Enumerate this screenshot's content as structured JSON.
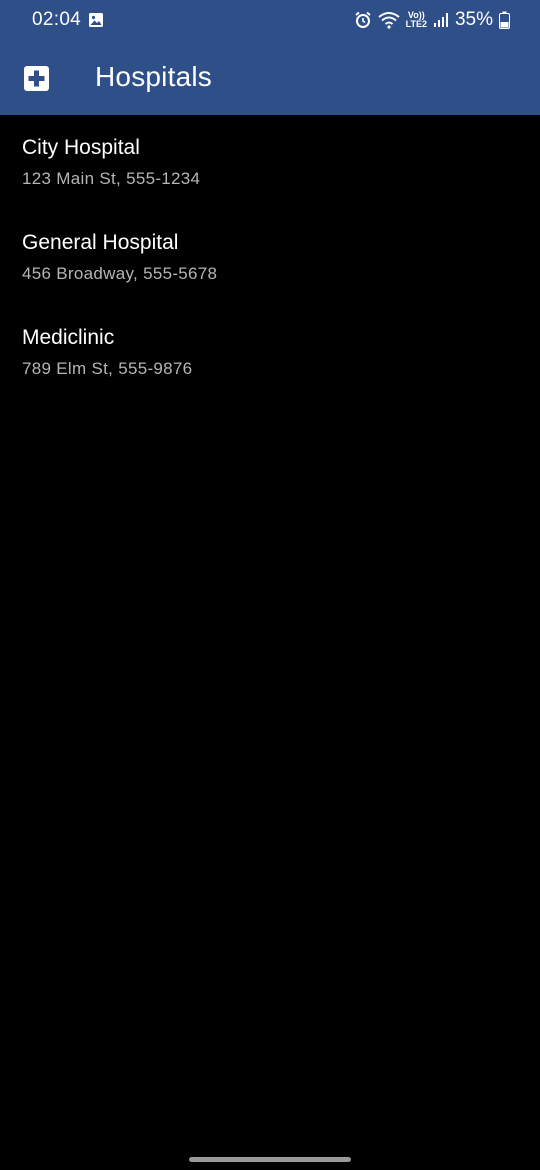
{
  "status_bar": {
    "time": "02:04",
    "network_top": "Vo))",
    "network_bottom": "LTE2",
    "battery": "35%"
  },
  "app_bar": {
    "title": "Hospitals",
    "icon": "medical-cross-icon"
  },
  "hospitals": [
    {
      "name": "City Hospital",
      "detail": "123 Main St, 555-1234"
    },
    {
      "name": "General Hospital",
      "detail": "456 Broadway, 555-5678"
    },
    {
      "name": "Mediclinic",
      "detail": "789 Elm St, 555-9876"
    }
  ],
  "colors": {
    "app_bar": "#2f4f88",
    "background": "#000000",
    "primary_text": "#ffffff",
    "secondary_text": "#b5b5b5"
  }
}
